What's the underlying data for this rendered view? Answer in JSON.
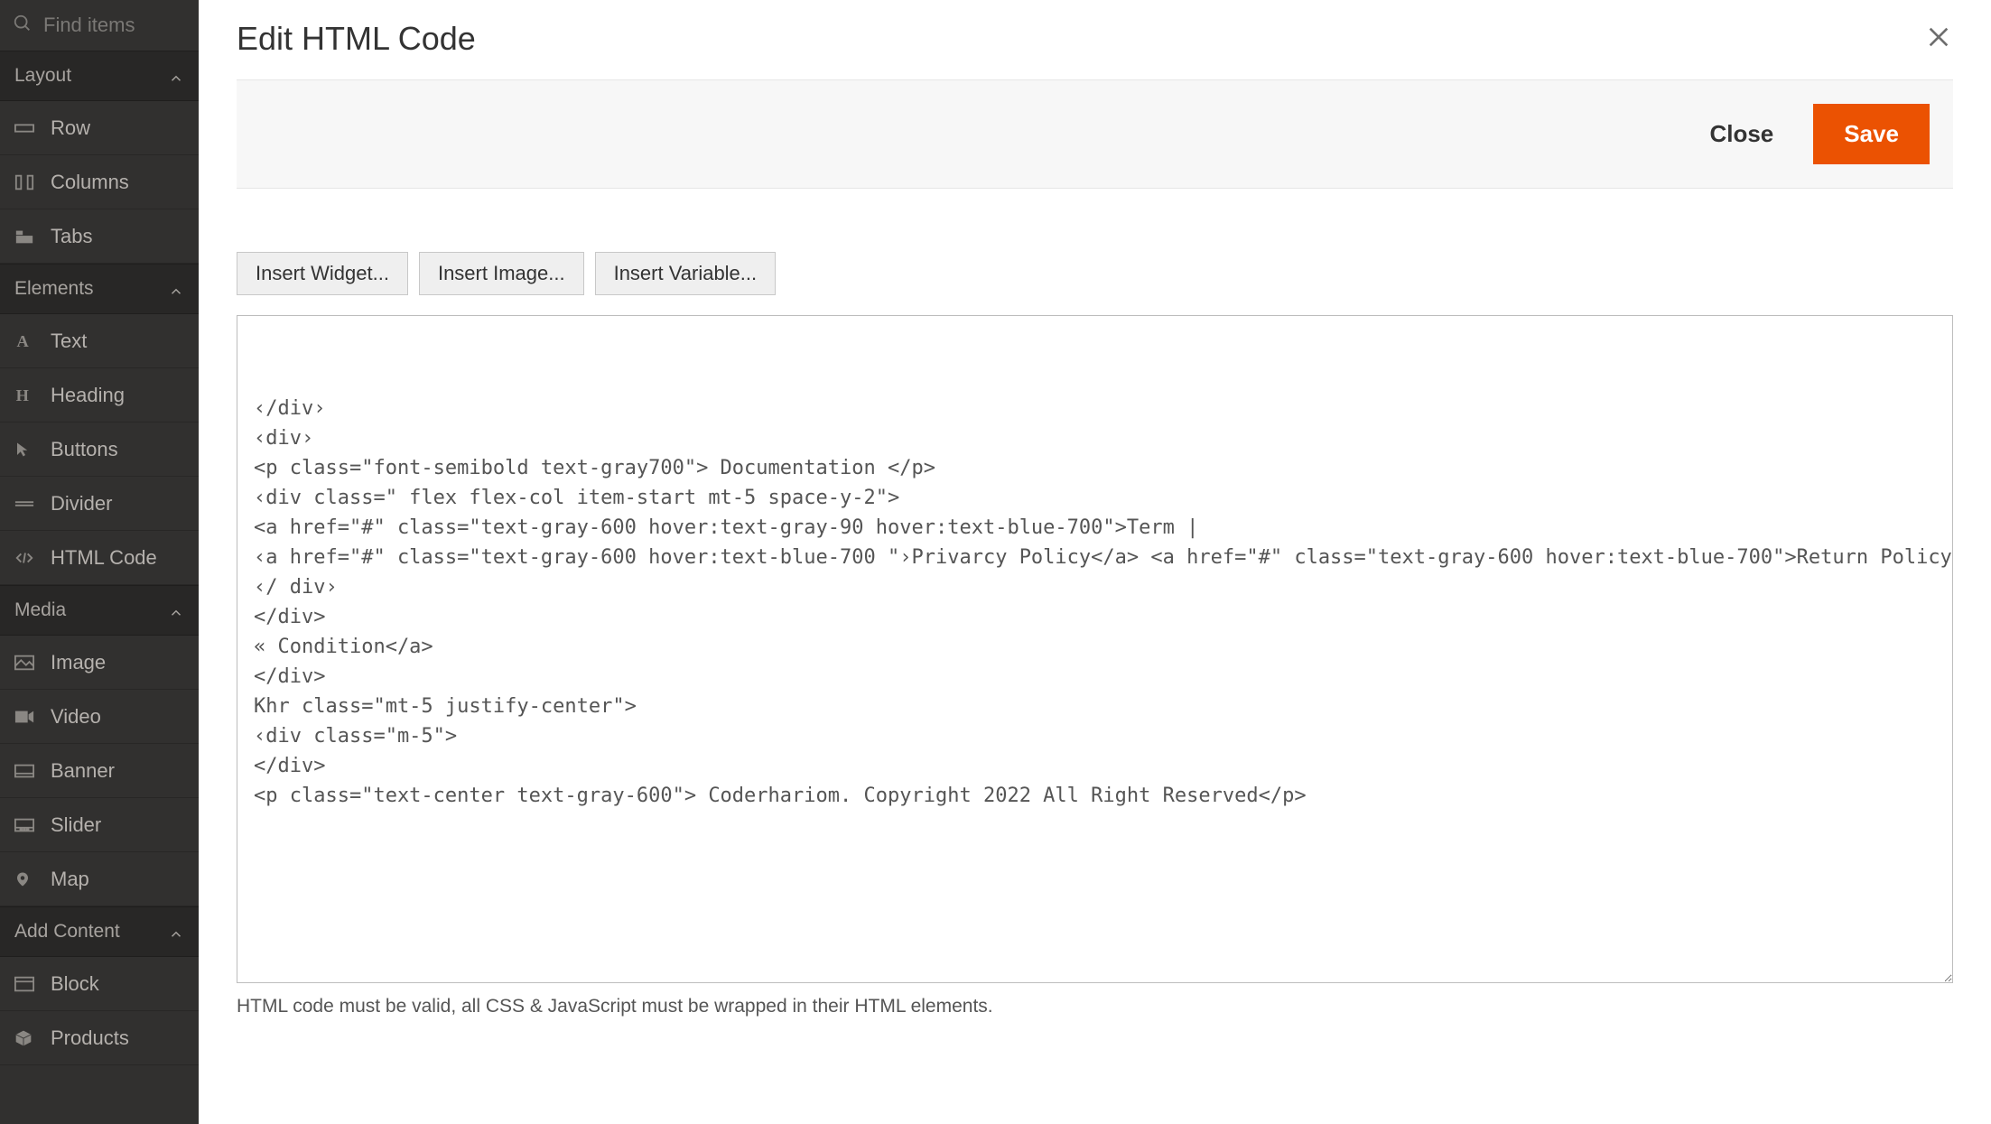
{
  "sidebar": {
    "search_placeholder": "Find items",
    "sections": {
      "layout": {
        "label": "Layout",
        "items": [
          "Row",
          "Columns",
          "Tabs"
        ]
      },
      "elements": {
        "label": "Elements",
        "items": [
          "Text",
          "Heading",
          "Buttons",
          "Divider",
          "HTML Code"
        ]
      },
      "media": {
        "label": "Media",
        "items": [
          "Image",
          "Video",
          "Banner",
          "Slider",
          "Map"
        ]
      },
      "add_content": {
        "label": "Add Content",
        "items": [
          "Block",
          "Products"
        ]
      }
    }
  },
  "modal": {
    "title": "Edit HTML Code",
    "actions": {
      "close": "Close",
      "save": "Save"
    },
    "insert": {
      "widget": "Insert Widget...",
      "image": "Insert Image...",
      "variable": "Insert Variable..."
    },
    "editor_value": "\n\n‹/div›\n‹div›\n<p class=\"font-semibold text-gray700\"> Documentation </p>\n‹div class=\" flex flex-col item-start mt-5 space-y-2\">\n<a href=\"#\" class=\"text-gray-600 hover:text-gray-90 hover:text-blue-700\">Term |\n‹a href=\"#\" class=\"text-gray-600 hover:text-blue-700 \"›Privarcy Policy</a> <a href=\"#\" class=\"text-gray-600 hover:text-blue-700\">Return Policy</a>\n‹/ div›\n</div>\n« Condition</a>\n</div>\nKhr class=\"mt-5 justify-center\">\n‹div class=\"m-5\">\n</div>\n<p class=\"text-center text-gray-600\"> Coderhariom. Copyright 2022 All Right Reserved</p>",
    "hint": "HTML code must be valid, all CSS & JavaScript must be wrapped in their HTML elements."
  }
}
